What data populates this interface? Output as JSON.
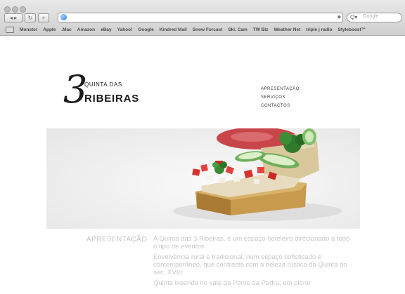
{
  "browser": {
    "search_placeholder": "Google",
    "bookmarks": [
      "Monster",
      "Apple",
      ".Mac",
      "Amazon",
      "eBay",
      "Yahoo!",
      "Google",
      "Kindred Mail",
      "Snow Forcast",
      "Ski. Cam",
      "TW Biz",
      "Weather Net",
      "triple j radio",
      "Styleboost™"
    ]
  },
  "site": {
    "logo": {
      "numeral": "3",
      "line1": "QUINTA DAS",
      "line2": "RIBEIRAS"
    },
    "menu": [
      "APRESENTAÇÃO",
      "SERVIÇOS",
      "CONTACTOS"
    ],
    "section": {
      "label": "APRESENTAÇÃO",
      "paragraphs": [
        "A Quinta das 3 Ribeiras, é um espaço hoteleiro direcionado a todo o tipo de eventos.",
        "Envolvência rural e tradicional, num espaço sofisticado e contemporâneo, que contrasta com a beleza rústica da Quinta do séc. XVIII.",
        "Quinta inserida no vale da Ponte da Pedra, em pleno"
      ]
    }
  }
}
